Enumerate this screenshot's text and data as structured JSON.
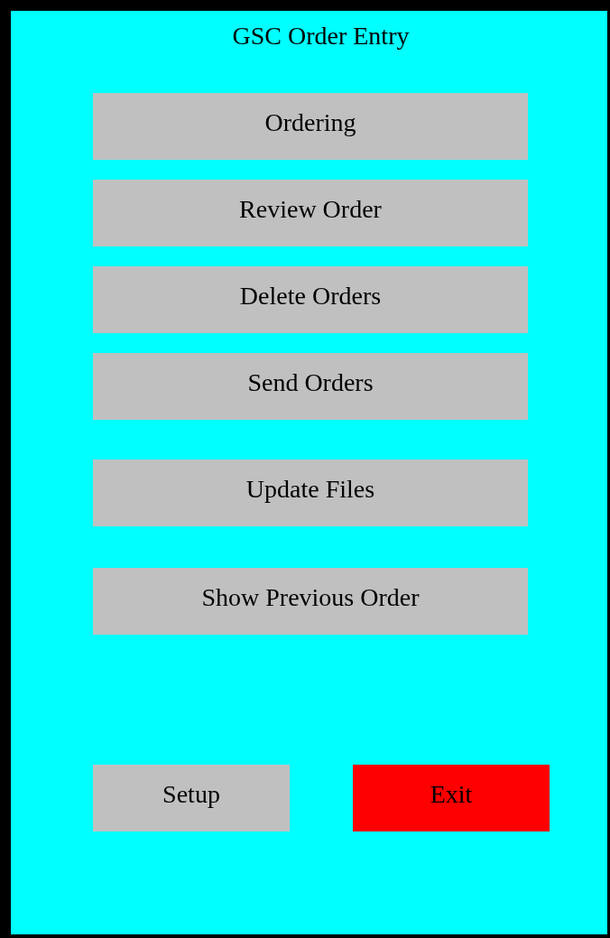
{
  "window": {
    "title": "GSC Order Entry"
  },
  "menu": [
    {
      "label": "Ordering"
    },
    {
      "label": "Review Order"
    },
    {
      "label": "Delete Orders"
    },
    {
      "label": "Send Orders"
    },
    {
      "label": "Update Files"
    },
    {
      "label": "Show Previous Order"
    }
  ],
  "footer_buttons": [
    {
      "label": "Setup",
      "kind": "normal"
    },
    {
      "label": "Exit",
      "kind": "danger"
    }
  ]
}
